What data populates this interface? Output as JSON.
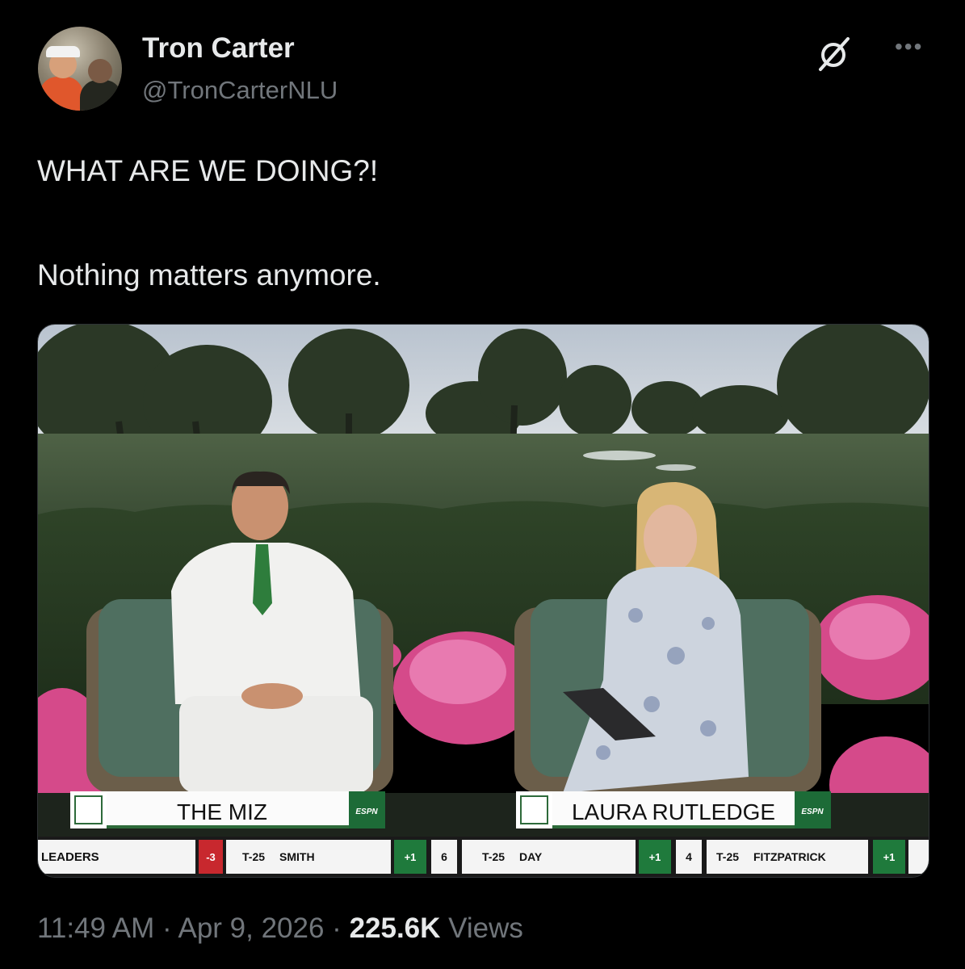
{
  "author": {
    "name": "Tron Carter",
    "handle": "@TronCarterNLU"
  },
  "tweet": {
    "line1": "WHAT ARE WE DOING?!",
    "line2": "Nothing matters anymore."
  },
  "media": {
    "lower_third_left": "THE MIZ",
    "lower_third_right": "LAURA RUTLEDGE",
    "network_logo": "ESPN",
    "ticker": {
      "label": "LEADERS",
      "items": [
        {
          "score": "-3",
          "pos": "T-25",
          "name": "SMITH"
        },
        {
          "score": "+1",
          "hole": "6",
          "pos": "T-25",
          "name": "DAY"
        },
        {
          "score": "+1",
          "hole": "4",
          "pos": "T-25",
          "name": "FITZPATRICK"
        },
        {
          "score": "+1"
        }
      ]
    }
  },
  "meta": {
    "time": "11:49 AM",
    "sep": "·",
    "date": "Apr 9, 2026",
    "views_count": "225.6K",
    "views_label": "Views"
  },
  "icons": [
    "grok-icon",
    "more-icon"
  ],
  "colors": {
    "background": "#000000",
    "text": "#e7e9ea",
    "muted": "#71767b",
    "score_red": "#c8282e",
    "score_green": "#1f7a3c"
  }
}
